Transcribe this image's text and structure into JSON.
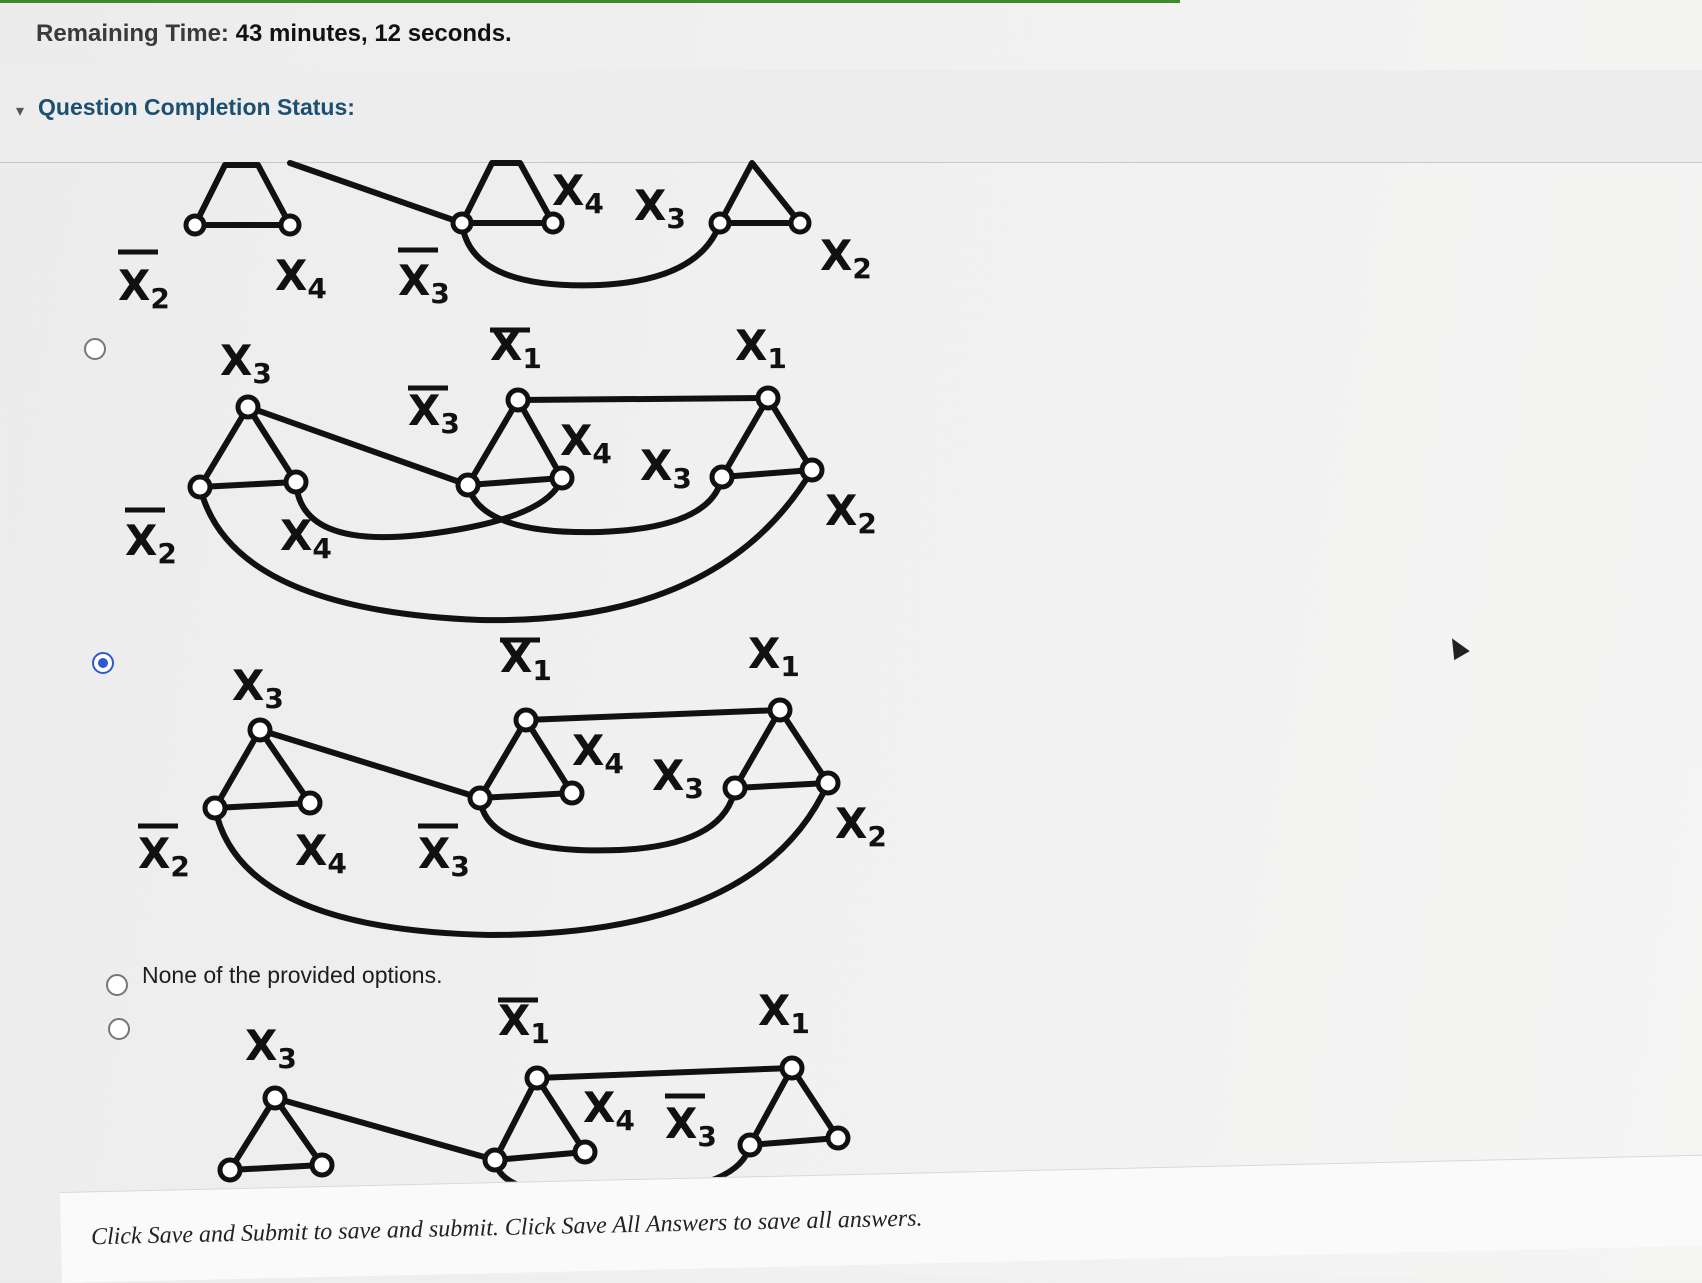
{
  "timer": {
    "label": "Remaining Time:",
    "value": "43 minutes, 12 seconds."
  },
  "status": {
    "label": "Question Completion Status:"
  },
  "options": [
    {
      "id": "a",
      "selected": false
    },
    {
      "id": "b",
      "selected": true
    },
    {
      "id": "c",
      "selected": false,
      "text": "None of the provided options."
    },
    {
      "id": "d",
      "selected": false
    }
  ],
  "graph_labels": {
    "x1": "X",
    "x2": "X",
    "x3": "X",
    "x4": "X",
    "sub1": "1",
    "sub2": "2",
    "sub3": "3",
    "sub4": "4"
  },
  "footer": {
    "text": "Click Save and Submit to save and submit. Click Save All Answers to save all answers."
  }
}
